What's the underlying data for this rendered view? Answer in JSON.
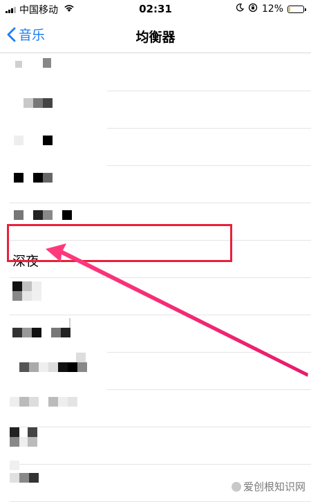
{
  "status_bar": {
    "carrier": "中国移动",
    "time": "02:31",
    "battery_percent": "12%",
    "battery_level": 0.12,
    "battery_color": "#f2c200",
    "icons": [
      "signal-icon",
      "wifi-icon",
      "moon-icon",
      "orientation-lock-icon",
      "battery-icon"
    ]
  },
  "nav": {
    "back_label": "音乐",
    "title": "均衡器",
    "accent_color": "#1a7ef5"
  },
  "list": {
    "highlighted_item": "深夜",
    "highlight_color": "#e8203a"
  },
  "watermark": {
    "text": "爱创根知识网"
  }
}
